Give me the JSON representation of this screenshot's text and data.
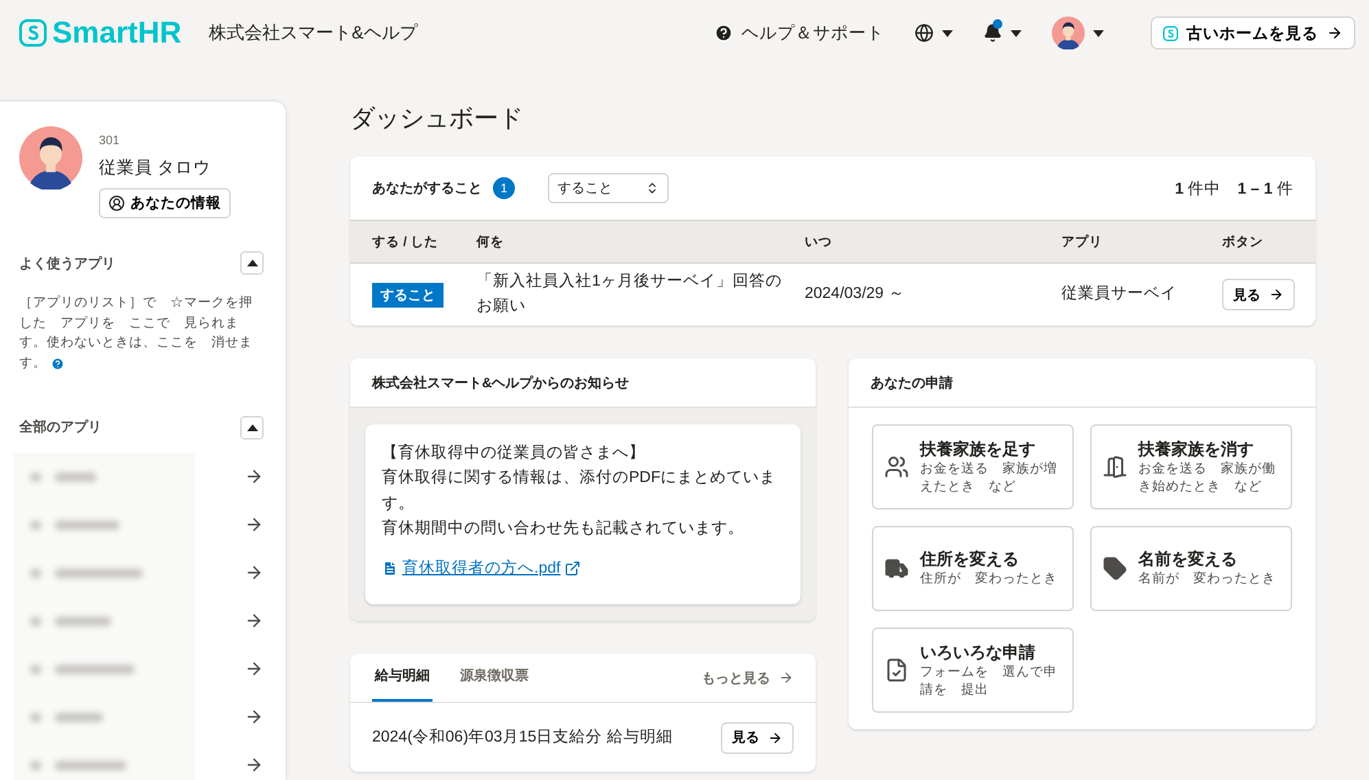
{
  "header": {
    "logo": "SmartHR",
    "company": "株式会社スマート&ヘルプ",
    "help": "ヘルプ＆サポート",
    "notification_dot": true,
    "old_home_button": "古いホームを見る"
  },
  "sidebar": {
    "employee_number": "301",
    "employee_name": "従業員 タロウ",
    "profile_button": "あなたの情報",
    "favorite_apps": {
      "title": "よく使うアプリ",
      "expanded": true,
      "description": "［アプリのリスト］で　☆マークを押した　アプリを　ここで　見られます。使わないときは、ここを　消せます。"
    },
    "all_apps": {
      "title": "全部のアプリ",
      "expanded": true,
      "items": [
        {
          "kind": "blurred"
        },
        {
          "kind": "blurred"
        },
        {
          "kind": "blurred"
        },
        {
          "kind": "blurred"
        },
        {
          "kind": "blurred"
        },
        {
          "kind": "blurred"
        },
        {
          "kind": "blurred"
        }
      ]
    }
  },
  "page_title": "ダッシュボード",
  "todo": {
    "title": "あなたがすること",
    "count": "1",
    "filter": "すること",
    "pagination_total": "1",
    "pagination_total_suffix": "件中",
    "pagination_range": "1 – 1",
    "pagination_range_suffix": "件",
    "columns": [
      "する / した",
      "何を",
      "いつ",
      "アプリ",
      "ボタン"
    ],
    "rows": [
      {
        "status": "すること",
        "what": "「新入社員入社1ヶ月後サーベイ」回答のお願い",
        "when": "2024/03/29 ～",
        "app": "従業員サーベイ",
        "button": "見る"
      }
    ]
  },
  "notice": {
    "title": "株式会社スマート&ヘルプからのお知らせ",
    "heading": "【育休取得中の従業員の皆さまへ】",
    "lines": [
      "育休取得に関する情報は、添付のPDFにまとめています。",
      "育休期間中の問い合わせ先も記載されています。"
    ],
    "attachment": "育休取得者の方へ.pdf"
  },
  "payslip": {
    "tabs": [
      {
        "label": "給与明細",
        "selected": true
      },
      {
        "label": "源泉徴収票",
        "selected": false
      }
    ],
    "more_link": "もっと見る",
    "items": [
      {
        "title": "2024(令和06)年03月15日支給分 給与明細",
        "button": "見る"
      }
    ]
  },
  "requests": {
    "title": "あなたの申請",
    "items": [
      {
        "kind": "people",
        "title": "扶養家族を足す",
        "description": "お金を送る　家族が増えたとき　など"
      },
      {
        "kind": "door",
        "title": "扶養家族を消す",
        "description": "お金を送る　家族が働き始めたとき　など"
      },
      {
        "kind": "truck",
        "title": "住所を変える",
        "description": "住所が　変わったとき"
      },
      {
        "kind": "tag",
        "title": "名前を変える",
        "description": "名前が　変わったとき"
      },
      {
        "kind": "form",
        "title": "いろいろな申請",
        "description": "フォームを　選んで申請を　提出"
      }
    ]
  }
}
